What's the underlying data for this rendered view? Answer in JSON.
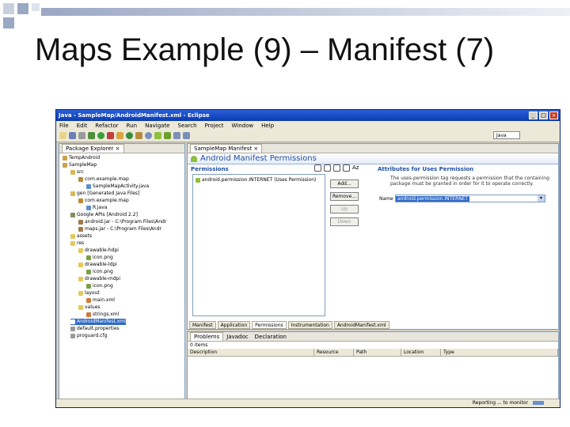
{
  "slide": {
    "title": "Maps Example (9) – Manifest (7)"
  },
  "window": {
    "title": "Java - SampleMap/AndroidManifest.xml - Eclipse",
    "minimize": "_",
    "maximize": "□",
    "close": "×"
  },
  "menu": [
    "File",
    "Edit",
    "Refactor",
    "Run",
    "Navigate",
    "Search",
    "Project",
    "Window",
    "Help"
  ],
  "toolbar": {
    "perspective": "Java"
  },
  "package_explorer": {
    "tab": "Package Explorer",
    "close": "×",
    "tree": [
      "TempAndroid",
      "SampleMap",
      "src",
      "com.example.map",
      "SampleMapActivity.java",
      "gen [Generated Java Files]",
      "com.example.map",
      "R.java",
      "Google APIs [Android 2.2]",
      "android.jar - C:\\Program Files\\Andr",
      "maps.jar - C:\\Program Files\\Andr",
      "assets",
      "res",
      "drawable-hdpi",
      "icon.png",
      "drawable-ldpi",
      "icon.png",
      "drawable-mdpi",
      "icon.png",
      "layout",
      "main.xml",
      "values",
      "strings.xml",
      "AndroidManifest.xml",
      "default.properties",
      "proguard.cfg"
    ]
  },
  "editor": {
    "tab": "SampleMap Manifest",
    "close": "×",
    "heading": "Android Manifest Permissions",
    "permissions_label": "Permissions",
    "sort_label": "Az",
    "permission_item": "android.permission.INTERNET (Uses Permission)",
    "buttons": {
      "add": "Add...",
      "remove": "Remove...",
      "up": "Up",
      "down": "Down"
    },
    "attributes_label": "Attributes for Uses Permission",
    "description": "The uses-permission tag requests a permission that the containing package must be granted in order for it to operate correctly.",
    "name_label": "Name",
    "name_value": "android.permission.INTERNET",
    "bottom_tabs": [
      "Manifest",
      "Application",
      "Permissions",
      "Instrumentation",
      "AndroidManifest.xml"
    ]
  },
  "problems": {
    "tabs": [
      "Problems",
      "Javadoc",
      "Declaration"
    ],
    "summary": "0 items",
    "columns": [
      "Description",
      "Resource",
      "Path",
      "Location",
      "Type"
    ]
  },
  "status": {
    "text": "Reporting ... to monitor"
  },
  "colors": {
    "title_bar": "#0a3bb0",
    "selection": "#316ac5",
    "form_heading": "#1f4fa3"
  }
}
